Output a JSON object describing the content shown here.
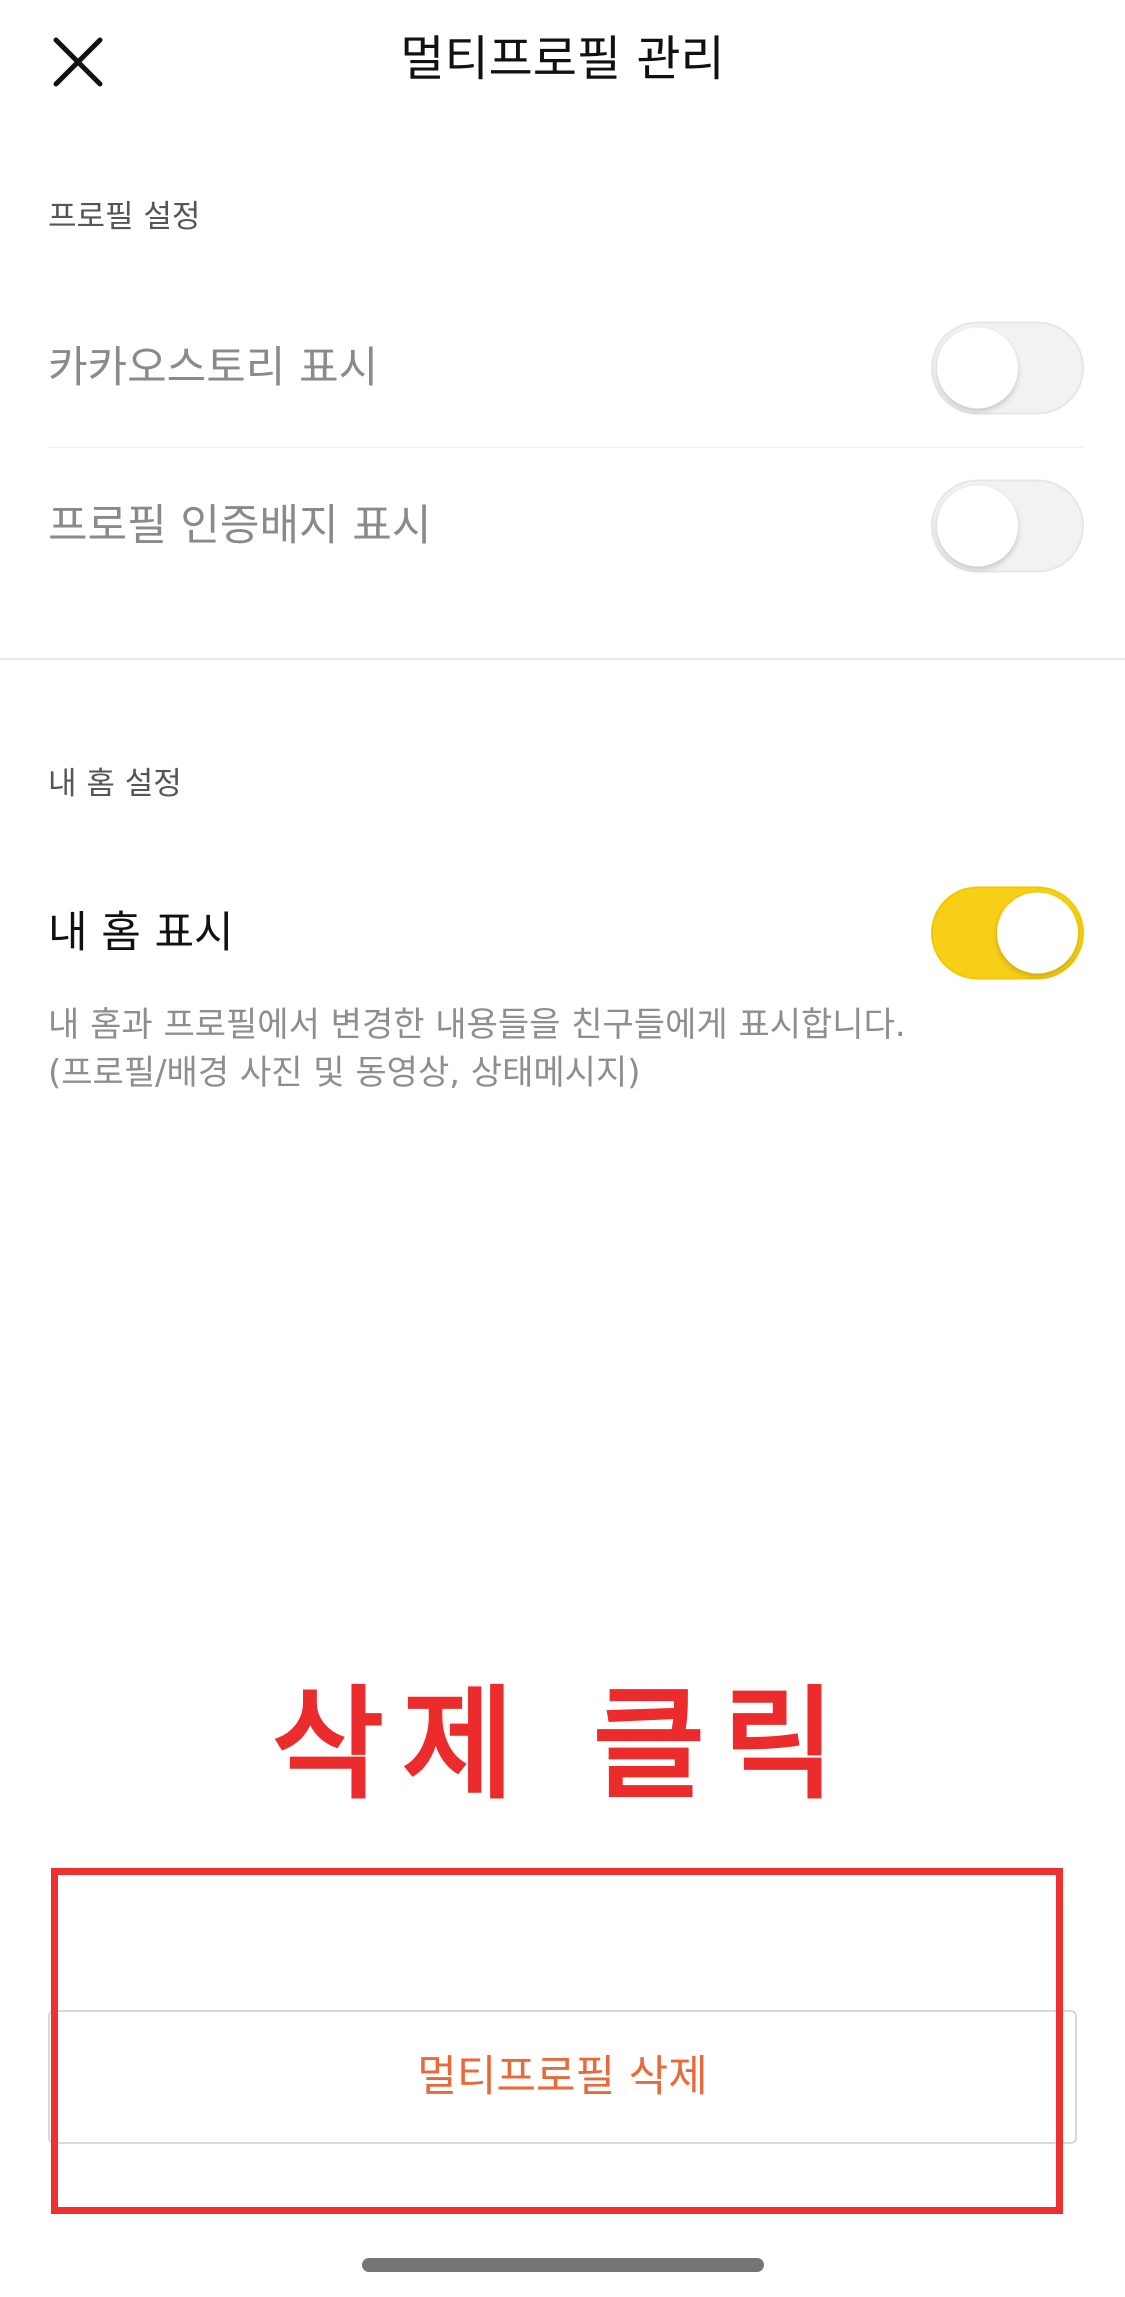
{
  "header": {
    "title": "멀티프로필 관리",
    "close_icon": "close-icon"
  },
  "profile_settings": {
    "section_label": "프로필 설정",
    "items": [
      {
        "label": "카카오스토리 표시",
        "enabled": false
      },
      {
        "label": "프로필 인증배지 표시",
        "enabled": false
      }
    ]
  },
  "home_settings": {
    "section_label": "내 홈 설정",
    "item": {
      "label": "내 홈 표시",
      "enabled": true
    },
    "description_line1": "내 홈과 프로필에서 변경한 내용들을 친구들에게 표시합니다.",
    "description_line2": "(프로필/배경 사진 및 동영상, 상태메시지)"
  },
  "annotation": {
    "text": "삭제 클릭",
    "color": "#ec2c2c"
  },
  "footer": {
    "delete_label": "멀티프로필 삭제",
    "delete_color": "#e86a3a"
  },
  "colors": {
    "toggle_on": "#f7cf16",
    "toggle_off": "#f2f2f2"
  }
}
